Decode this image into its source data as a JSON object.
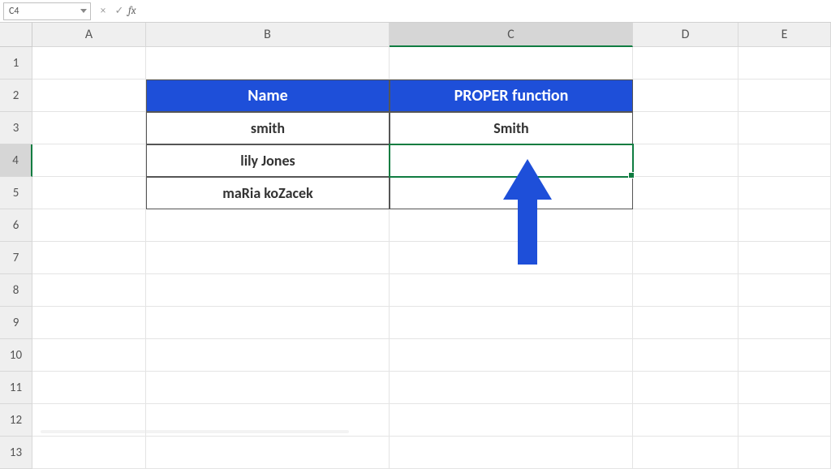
{
  "nameBox": {
    "value": "C4"
  },
  "formulaBar": {
    "cancel": "×",
    "enter": "✓",
    "fx": "fx",
    "value": ""
  },
  "columns": [
    "A",
    "B",
    "C",
    "D",
    "E"
  ],
  "rows": [
    "1",
    "2",
    "3",
    "4",
    "5",
    "6",
    "7",
    "8",
    "9",
    "10",
    "11",
    "12",
    "13"
  ],
  "table": {
    "headers": {
      "b": "Name",
      "c": "PROPER function"
    },
    "rows": [
      {
        "b": "smith",
        "c": "Smith"
      },
      {
        "b": "lily Jones",
        "c": ""
      },
      {
        "b": "maRia koZacek",
        "c": ""
      }
    ]
  },
  "activeCell": "C4",
  "activeCol": "C",
  "activeRow": "4",
  "arrowColor": "#1e4fd9"
}
